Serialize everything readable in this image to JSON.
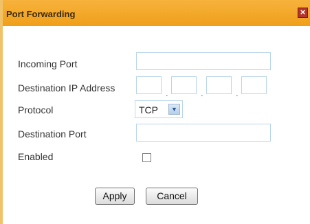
{
  "dialog": {
    "title": "Port Forwarding",
    "close_icon": "close-icon"
  },
  "form": {
    "incoming_port_label": "Incoming Port",
    "incoming_port_value": "",
    "destination_ip_label": "Destination IP Address",
    "ip_octets": [
      "",
      "",
      "",
      ""
    ],
    "ip_separator": ".",
    "protocol_label": "Protocol",
    "protocol_value": "TCP",
    "destination_port_label": "Destination Port",
    "destination_port_value": "",
    "enabled_label": "Enabled",
    "enabled_checked": false
  },
  "buttons": {
    "apply_label": "Apply",
    "cancel_label": "Cancel"
  },
  "colors": {
    "titlebar": "#f0a326",
    "close_button": "#b2342a",
    "input_border": "#b9d6ea"
  }
}
